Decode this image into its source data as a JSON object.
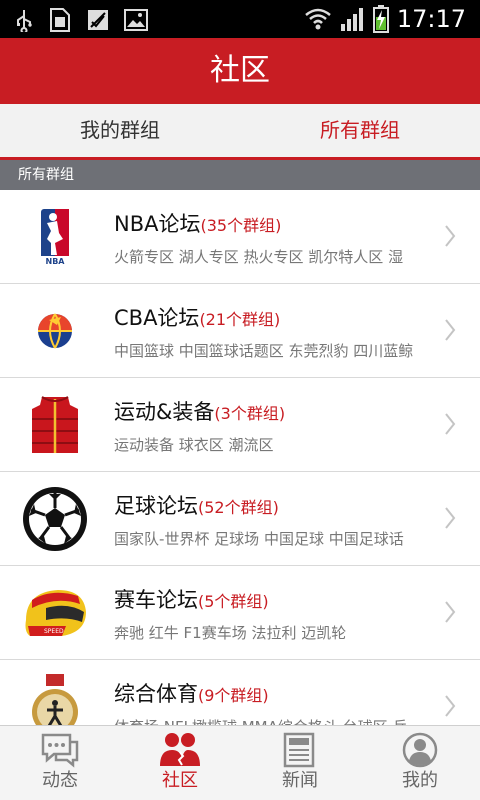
{
  "status_bar": {
    "time": "17:17",
    "icons": [
      "usb-icon",
      "sim-icon",
      "no-sim-icon",
      "image-icon",
      "wifi-icon",
      "signal-icon",
      "battery-charging-icon"
    ]
  },
  "header": {
    "title": "社区"
  },
  "tabs": [
    {
      "label": "我的群组",
      "active": false
    },
    {
      "label": "所有群组",
      "active": true
    }
  ],
  "section": {
    "title": "所有群组"
  },
  "groups": [
    {
      "name": "NBA论坛",
      "count": "(35个群组)",
      "subs": "火箭专区 湖人专区 热火专区 凯尔特人区 湿",
      "icon": "nba-logo-icon"
    },
    {
      "name": "CBA论坛",
      "count": "(21个群组)",
      "subs": "中国篮球 中国篮球话题区 东莞烈豹 四川蓝鲸",
      "icon": "cba-logo-icon"
    },
    {
      "name": "运动&装备",
      "count": "(3个群组)",
      "subs": "运动装备 球衣区 潮流区",
      "icon": "red-vest-icon"
    },
    {
      "name": "足球论坛",
      "count": "(52个群组)",
      "subs": "国家队-世界杯 足球场 中国足球 中国足球话",
      "icon": "soccer-ball-icon"
    },
    {
      "name": "赛车论坛",
      "count": "(5个群组)",
      "subs": "奔驰 红牛 F1赛车场 法拉利 迈凯轮",
      "icon": "racing-helmet-icon"
    },
    {
      "name": "综合体育",
      "count": "(9个群组)",
      "subs": "体育场 NFL橄榄球 MMA综合格斗 台球区 乒",
      "icon": "sports-medal-icon"
    }
  ],
  "bottom_nav": [
    {
      "label": "动态",
      "icon": "chat-bubble-icon",
      "active": false
    },
    {
      "label": "社区",
      "icon": "community-icon",
      "active": true
    },
    {
      "label": "新闻",
      "icon": "news-icon",
      "active": false
    },
    {
      "label": "我的",
      "icon": "profile-icon",
      "active": false
    }
  ],
  "colors": {
    "brand_red": "#c81d23",
    "section_gray": "#6e7076"
  }
}
